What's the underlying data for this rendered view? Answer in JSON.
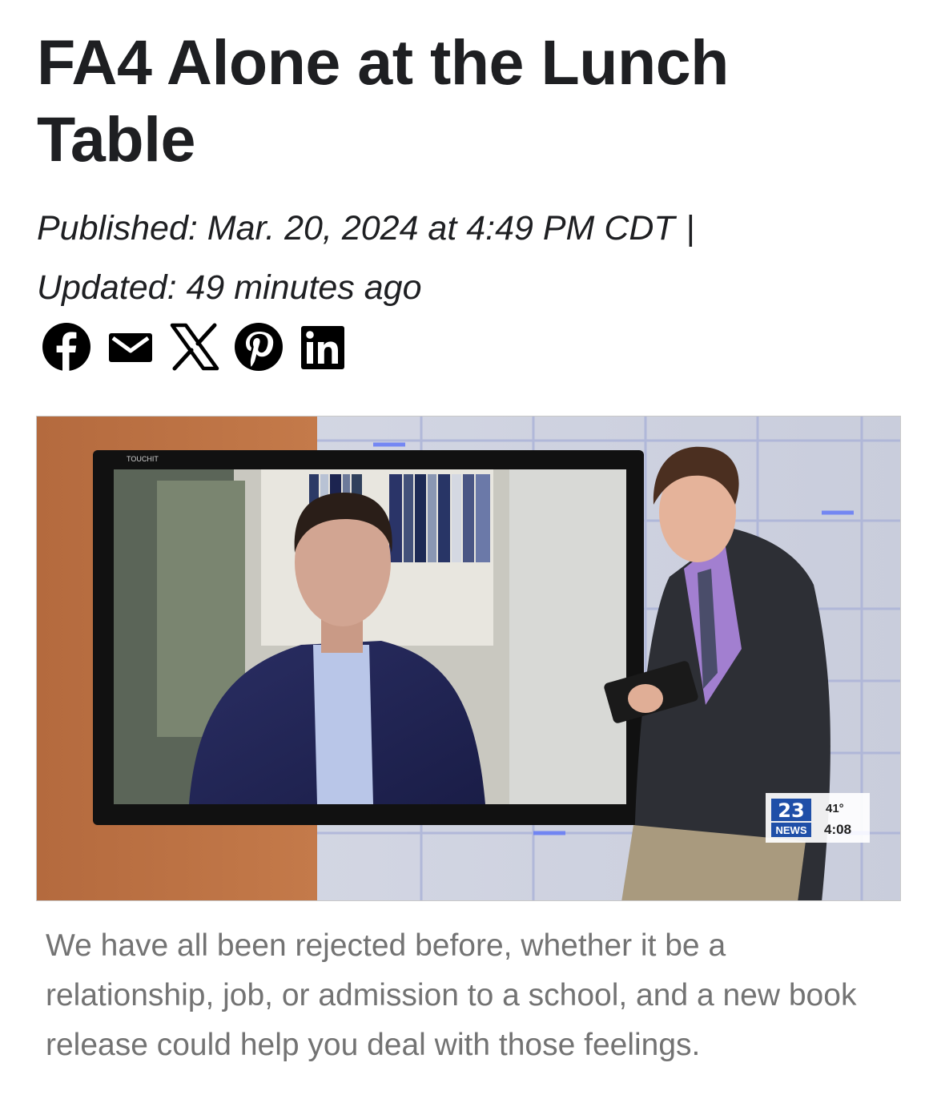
{
  "article": {
    "headline": "FA4 Alone at the Lunch Table",
    "published": "Published: Mar. 20, 2024 at 4:49 PM CDT",
    "separator": "|",
    "updated": "Updated: 49 minutes ago",
    "caption": "We have all been rejected before, whether it be a relationship, job, or admission to a school, and a new book release could help you deal with those feelings."
  },
  "share": {
    "icons": [
      "facebook-icon",
      "email-icon",
      "x-icon",
      "pinterest-icon",
      "linkedin-icon"
    ]
  },
  "media": {
    "monitor_brand": "TOUCHIT",
    "bug": {
      "channel": "23",
      "network": "NEWS",
      "temperature": "41°",
      "time": "4:08"
    }
  },
  "colors": {
    "text": "#1e1f22",
    "caption": "#737373",
    "news_blue": "#1f4fa8"
  }
}
